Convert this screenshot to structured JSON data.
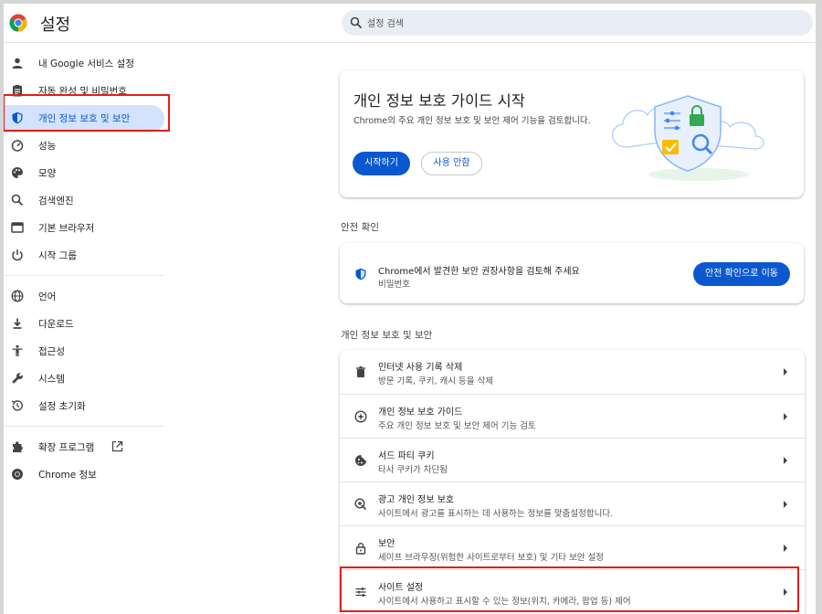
{
  "header": {
    "app_title": "설정",
    "search_placeholder": "설정 검색"
  },
  "sidebar": {
    "items": [
      {
        "label": "내 Google 서비스 설정",
        "icon": "person-icon"
      },
      {
        "label": "자동 완성 및 비밀번호",
        "icon": "clipboard-icon"
      },
      {
        "label": "개인 정보 보호 및 보안",
        "icon": "shield-icon",
        "active": true
      },
      {
        "label": "성능",
        "icon": "speedometer-icon"
      },
      {
        "label": "모양",
        "icon": "palette-icon"
      },
      {
        "label": "검색엔진",
        "icon": "search-icon"
      },
      {
        "label": "기본 브라우저",
        "icon": "browser-icon"
      },
      {
        "label": "시작 그룹",
        "icon": "power-icon"
      },
      {
        "label": "언어",
        "icon": "globe-icon"
      },
      {
        "label": "다운로드",
        "icon": "download-icon"
      },
      {
        "label": "접근성",
        "icon": "accessibility-icon"
      },
      {
        "label": "시스템",
        "icon": "wrench-icon"
      },
      {
        "label": "설정 초기화",
        "icon": "history-icon"
      },
      {
        "label": "확장 프로그램",
        "icon": "puzzle-icon"
      },
      {
        "label": "Chrome 정보",
        "icon": "chrome-icon"
      }
    ]
  },
  "hero": {
    "title": "개인 정보 보호 가이드 시작",
    "description": "Chrome의 주요 개인 정보 보호 및 보안 제어 기능을 검토합니다.",
    "primary_button": "시작하기",
    "secondary_button": "사용 안함"
  },
  "safety_check": {
    "section_title": "안전 확인",
    "message": "Chrome에서 발견한 보안 권장사항을 검토해 주세요",
    "sub": "비밀번호",
    "button": "안전 확인으로 이동"
  },
  "privacy": {
    "section_title": "개인 정보 보호 및 보안",
    "rows": [
      {
        "title": "인터넷 사용 기록 삭제",
        "sub": "방문 기록, 쿠키, 캐시 등을 삭제",
        "icon": "trash-icon"
      },
      {
        "title": "개인 정보 보호 가이드",
        "sub": "주요 개인 정보 보호 및 보안 제어 기능 검토",
        "icon": "compass-icon"
      },
      {
        "title": "서드 파티 쿠키",
        "sub": "타사 쿠키가 차단됨",
        "icon": "cookie-icon"
      },
      {
        "title": "광고 개인 정보 보호",
        "sub": "사이트에서 광고를 표시하는 데 사용하는 정보를 맞춤설정합니다.",
        "icon": "ad-privacy-icon"
      },
      {
        "title": "보안",
        "sub": "세이프 브라우징(위험한 사이트로부터 보호) 및 기타 보안 설정",
        "icon": "lock-icon"
      },
      {
        "title": "사이트 설정",
        "sub": "사이트에서 사용하고 표시할 수 있는 정보(위치, 카메라, 팝업 등) 제어",
        "icon": "tune-icon"
      }
    ]
  },
  "colors": {
    "accent": "#0b57d0",
    "active_bg": "#d3e3fd",
    "highlight_box": "#e0201b"
  }
}
